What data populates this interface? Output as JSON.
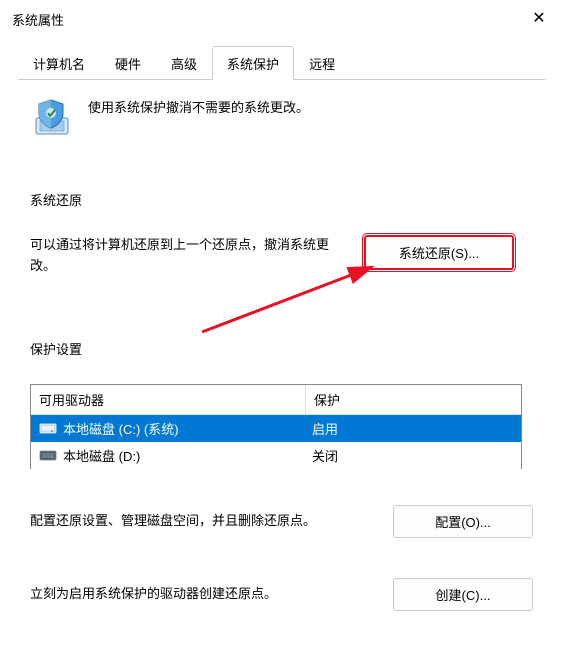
{
  "window": {
    "title": "系统属性"
  },
  "tabs": [
    {
      "label": "计算机名"
    },
    {
      "label": "硬件"
    },
    {
      "label": "高级"
    },
    {
      "label": "系统保护",
      "active": true
    },
    {
      "label": "远程"
    }
  ],
  "intro": "使用系统保护撤消不需要的系统更改。",
  "sections": {
    "restore": {
      "heading": "系统还原",
      "text": "可以通过将计算机还原到上一个还原点，撤消系统更改。",
      "button": "系统还原(S)..."
    },
    "settings": {
      "heading": "保护设置",
      "table_header_drive": "可用驱动器",
      "table_header_status": "保护",
      "drives": [
        {
          "name": "本地磁盘 (C:) (系统)",
          "status": "启用",
          "selected": true
        },
        {
          "name": "本地磁盘 (D:)",
          "status": "关闭",
          "selected": false
        }
      ],
      "config_text": "配置还原设置、管理磁盘空间，并且删除还原点。",
      "config_button": "配置(O)...",
      "create_text": "立刻为启用系统保护的驱动器创建还原点。",
      "create_button": "创建(C)..."
    }
  }
}
